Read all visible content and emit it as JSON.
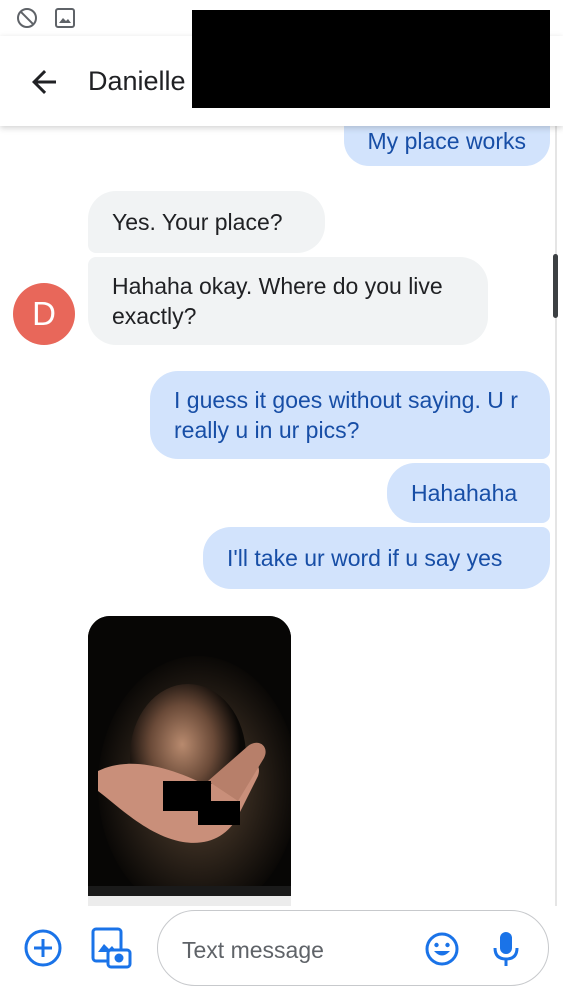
{
  "status_bar": {
    "icons": [
      "do-not-disturb-icon",
      "image-icon"
    ]
  },
  "header": {
    "back_icon": "arrow-back-icon",
    "contact_name": "Danielle"
  },
  "conversation": {
    "avatar_letter": "D",
    "messages": [
      {
        "direction": "outgoing",
        "text": "My place works"
      },
      {
        "direction": "incoming",
        "text": "Yes. Your place?"
      },
      {
        "direction": "incoming",
        "text": "Hahaha okay. Where do you live exactly?"
      },
      {
        "direction": "outgoing",
        "text": "I guess it goes without saying. U r really u in ur pics?"
      },
      {
        "direction": "outgoing",
        "text": "Hahahaha"
      },
      {
        "direction": "outgoing",
        "text": "I'll take ur word if u say yes"
      }
    ],
    "photo_message": {
      "direction": "incoming",
      "type": "image"
    }
  },
  "composer": {
    "add_icon": "add-circle-icon",
    "gallery_icon": "gallery-camera-icon",
    "placeholder": "Text message",
    "emoji_icon": "emoji-icon",
    "mic_icon": "microphone-icon"
  },
  "colors": {
    "outgoing_bubble": "#d2e3fc",
    "outgoing_text": "#174ea6",
    "incoming_bubble": "#f1f3f4",
    "avatar": "#e8675a",
    "accent": "#1a73e8"
  }
}
